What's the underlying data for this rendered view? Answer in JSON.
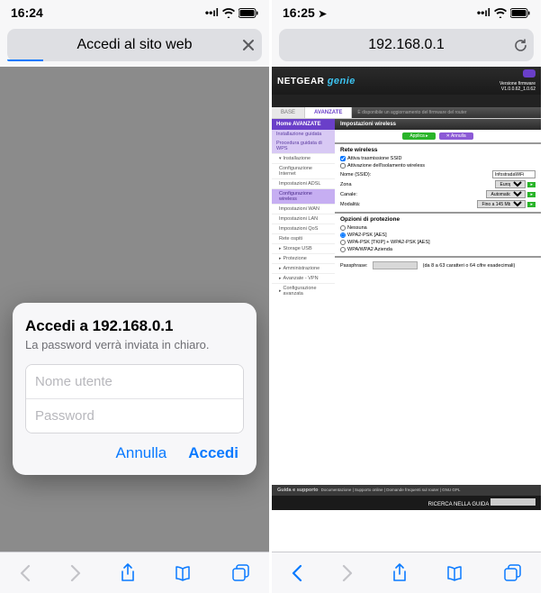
{
  "left": {
    "status": {
      "time": "16:24"
    },
    "urlbar": {
      "title": "Accedi al sito web",
      "loading": true
    },
    "dialog": {
      "title": "Accedi a 192.168.0.1",
      "message": "La password verrà inviata in chiaro.",
      "username_placeholder": "Nome utente",
      "password_placeholder": "Password",
      "cancel": "Annulla",
      "submit": "Accedi"
    }
  },
  "right": {
    "status": {
      "time": "16:25"
    },
    "urlbar": {
      "title": "192.168.0.1"
    },
    "router": {
      "brand_a": "NETGEAR",
      "brand_b": "genie",
      "version_label": "Versione firmware",
      "version_value": "V1.0.0.62_1.0.62",
      "tabs": {
        "basic": "BASE",
        "advanced": "AVANZATE",
        "banner": "È disponibile un aggiornamento del firmware del router"
      },
      "sidebar": {
        "group_top": "Home AVANZATE",
        "group_wiz": "Installazione guidata",
        "group_wps": "Procedura guidata di WPS",
        "sections": [
          {
            "label": "Installazione",
            "expanded": true,
            "items": [
              "Configurazione Internet",
              "Impostazioni ADSL",
              "Configurazione wireless",
              "Impostazioni WAN",
              "Impostazioni LAN",
              "Impostazioni QoS",
              "Rete ospiti"
            ]
          },
          {
            "label": "Storage USB",
            "expanded": false
          },
          {
            "label": "Protezione",
            "expanded": false
          },
          {
            "label": "Amministrazione",
            "expanded": false
          },
          {
            "label": "Avanzate - VPN",
            "expanded": false
          },
          {
            "label": "Configurazione avanzata",
            "expanded": false
          }
        ],
        "selected_item": "Configurazione wireless"
      },
      "main": {
        "title": "Impostazioni wireless",
        "apply": "Applica ▸",
        "cancel": "✕ Annulla",
        "region_label": "Zona",
        "section1_title": "Rete wireless",
        "chk_enable_ssid": "Attiva trasmissione SSID",
        "chk_isolation": "Attivazione dell'isolamento wireless",
        "name_label": "Nome (SSID):",
        "name_value": "InfostradaWiFi",
        "chan_label": "Canale:",
        "chan_value": "Europa",
        "mode_label": "Modalità:",
        "mode_value": "Automatico",
        "speed_label": "",
        "speed_value": "Fino a 145 Mbps",
        "section2_title": "Opzioni di protezione",
        "sec_options": [
          "Nessuna",
          "WPA2-PSK [AES]",
          "WPA-PSK [TKIP] + WPA2-PSK [AES]",
          "WPA/WPA2 Azienda"
        ],
        "sec_selected": 1,
        "pass_label": "Passphrase:",
        "pass_hint": "(da 8 a 63 caratteri o 64 cifre esadecimali)"
      },
      "footer": {
        "line1_a": "Guida e supporto",
        "line1_b": "Documentazione | Supporto online | Domande frequenti sul router | GNU GPL",
        "search_label": "RICERCA NELLA GUIDA"
      }
    }
  }
}
